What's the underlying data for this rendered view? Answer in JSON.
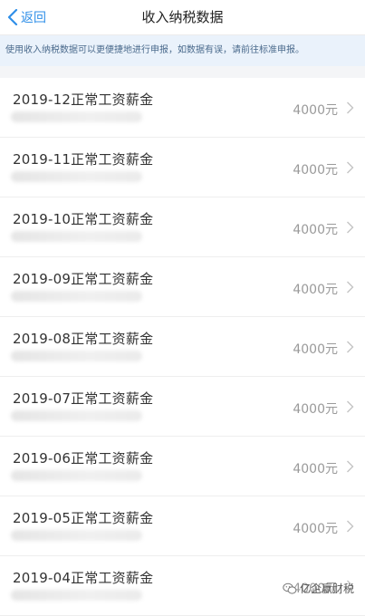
{
  "header": {
    "back_label": "返回",
    "title": "收入纳税数据"
  },
  "notice": {
    "text": "使用收入纳税数据可以更便捷地进行申报，如数据有误，请前往标准申报。"
  },
  "records": [
    {
      "title": "2019-12正常工资薪金",
      "amount": "4000元"
    },
    {
      "title": "2019-11正常工资薪金",
      "amount": "4000元"
    },
    {
      "title": "2019-10正常工资薪金",
      "amount": "4000元"
    },
    {
      "title": "2019-09正常工资薪金",
      "amount": "4000元"
    },
    {
      "title": "2019-08正常工资薪金",
      "amount": "4000元"
    },
    {
      "title": "2019-07正常工资薪金",
      "amount": "4000元"
    },
    {
      "title": "2019-06正常工资薪金",
      "amount": "4000元"
    },
    {
      "title": "2019-05正常工资薪金",
      "amount": "4000元"
    },
    {
      "title": "2019-04正常工资薪金",
      "amount": "4000元"
    }
  ],
  "watermark": {
    "text": "亿企赢财税"
  },
  "colors": {
    "accent": "#2f8fe8",
    "notice_bg": "#eaf2fb",
    "amount_text": "#9a9a9a"
  },
  "icons": {
    "back": "chevron-left-icon",
    "row": "chevron-right-icon",
    "watermark": "wechat-icon"
  }
}
